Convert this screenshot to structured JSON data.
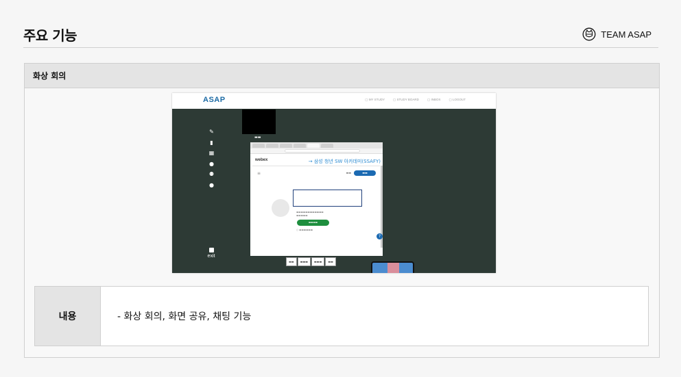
{
  "header": {
    "title": "주요 기능",
    "team_label": "TEAM ASAP"
  },
  "section": {
    "title": "화상 회의"
  },
  "screenshot": {
    "app_logo": "ASAP",
    "nav_items": [
      "MY STUDY",
      "STUDY BOARD",
      "INBOX",
      "LOGOUT"
    ],
    "side_icons": [
      "edit-icon",
      "clipboard-icon",
      "calendar-icon",
      "info-icon",
      "users-icon",
      "chat-icon"
    ],
    "exit_label": "exit",
    "webex_logo": "webex",
    "meeting_title": "→ 삼성 청년 SW 아카데미(SSAFY)",
    "help_glyph": "?"
  },
  "info": {
    "label": "내용",
    "value": "-  화상 회의, 화면 공유, 채팅 기능"
  },
  "colors": {
    "app_background": "#2d3a35",
    "brand_blue": "#1b6aa4",
    "join_green": "#1e8e3e"
  }
}
